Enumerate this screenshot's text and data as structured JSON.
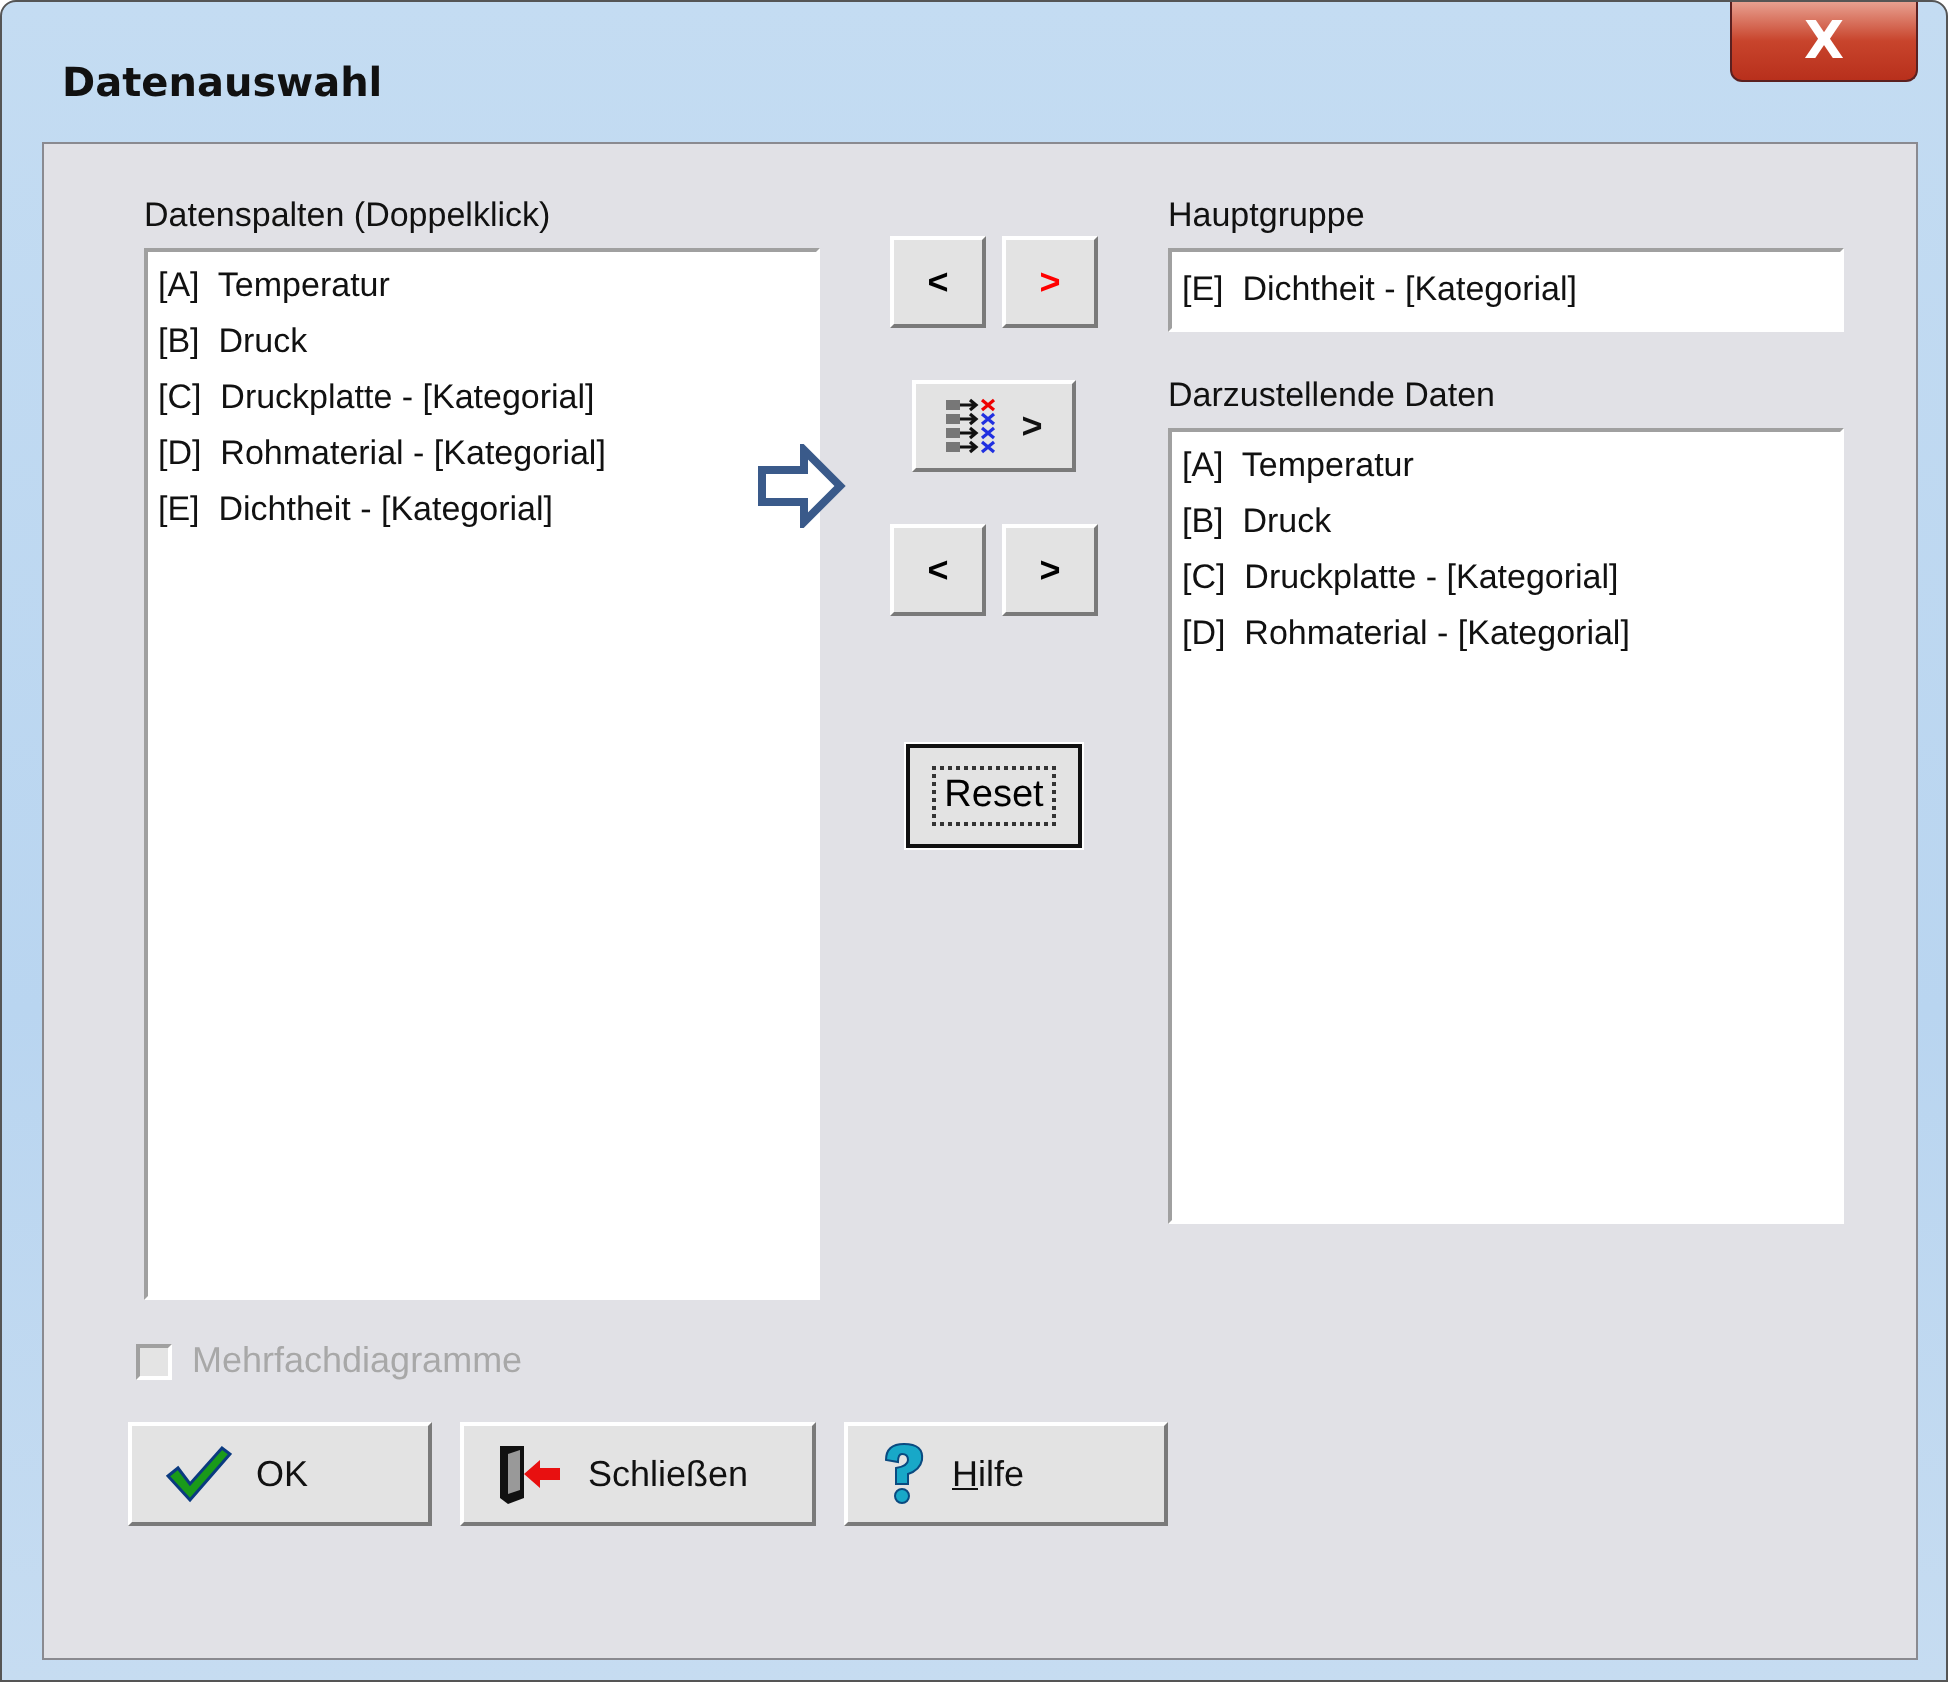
{
  "window": {
    "title": "Datenauswahl",
    "close_label": "X"
  },
  "source": {
    "label": "Datenspalten (Doppelklick)",
    "items": [
      "[A]  Temperatur",
      "[B]  Druck",
      "[C]  Druckplatte - [Kategorial]",
      "[D]  Rohmaterial - [Kategorial]",
      "[E]  Dichtheit - [Kategorial]"
    ]
  },
  "group_buttons": [
    {
      "label": "<",
      "color": "#000000"
    },
    {
      "label": ">",
      "color": "#ff0000"
    }
  ],
  "multi_button": {
    "label": ">"
  },
  "data_buttons": [
    {
      "label": "<",
      "color": "#000000"
    },
    {
      "label": ">",
      "color": "#000000"
    }
  ],
  "reset": {
    "label": "Reset",
    "focused": true
  },
  "main_group": {
    "label": "Hauptgruppe",
    "value": "[E]  Dichtheit - [Kategorial]"
  },
  "target": {
    "label": "Darzustellende Daten",
    "items": [
      "[A]  Temperatur",
      "[B]  Druck",
      "[C]  Druckplatte - [Kategorial]",
      "[D]  Rohmaterial - [Kategorial]"
    ]
  },
  "multi_diagrams": {
    "label": "Mehrfachdiagramme",
    "checked": false,
    "disabled": true
  },
  "footer_buttons": [
    {
      "kind": "ok",
      "label": "OK"
    },
    {
      "kind": "close",
      "label": "Schließen"
    },
    {
      "kind": "help",
      "label": "Hilfe"
    }
  ]
}
